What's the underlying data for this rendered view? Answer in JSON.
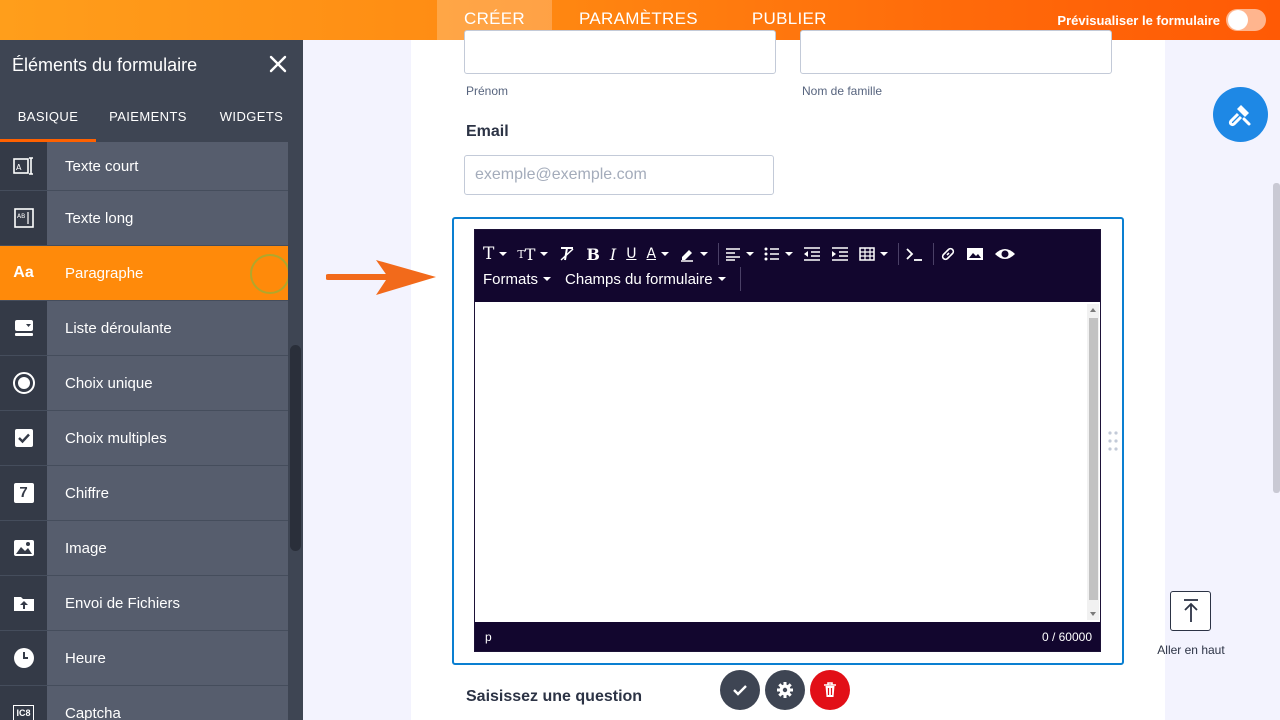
{
  "topbar": {
    "tabs": [
      "CRÉER",
      "PARAMÈTRES",
      "PUBLIER"
    ],
    "active_tab": "CRÉER",
    "preview_label": "Prévisualiser le formulaire",
    "preview_toggle_on": false
  },
  "sidebar": {
    "title": "Éléments du formulaire",
    "tabs": [
      "BASIQUE",
      "PAIEMENTS",
      "WIDGETS"
    ],
    "active_tab": "BASIQUE",
    "items": [
      {
        "label": "Texte court",
        "icon": "short-text-icon"
      },
      {
        "label": "Texte long",
        "icon": "long-text-icon"
      },
      {
        "label": "Paragraphe",
        "icon": "paragraph-icon",
        "icon_text": "Aa"
      },
      {
        "label": "Liste déroulante",
        "icon": "dropdown-icon"
      },
      {
        "label": "Choix unique",
        "icon": "radio-icon"
      },
      {
        "label": "Choix multiples",
        "icon": "checkbox-icon"
      },
      {
        "label": "Chiffre",
        "icon": "number-icon",
        "icon_text": "7"
      },
      {
        "label": "Image",
        "icon": "image-icon"
      },
      {
        "label": "Envoi de Fichiers",
        "icon": "upload-icon"
      },
      {
        "label": "Heure",
        "icon": "clock-icon"
      },
      {
        "label": "Captcha",
        "icon": "captcha-icon",
        "icon_text": "IC8"
      }
    ],
    "active_item": "Paragraphe"
  },
  "form": {
    "first_name_sublabel": "Prénom",
    "last_name_sublabel": "Nom de famille",
    "email_label": "Email",
    "email_placeholder": "exemple@exemple.com",
    "next_question": "Saisissez une question"
  },
  "editor": {
    "toolbar_dropdowns": [
      "Formats",
      "Champs du formulaire"
    ],
    "status_tag": "p",
    "char_count": "0 / 60000"
  },
  "right_panel": {
    "back_to_top_label": "Aller en haut"
  },
  "colors": {
    "accent": "#ff6100",
    "selection": "#0a7fd1",
    "editor_bar": "#12062e",
    "delete": "#e20f17"
  }
}
